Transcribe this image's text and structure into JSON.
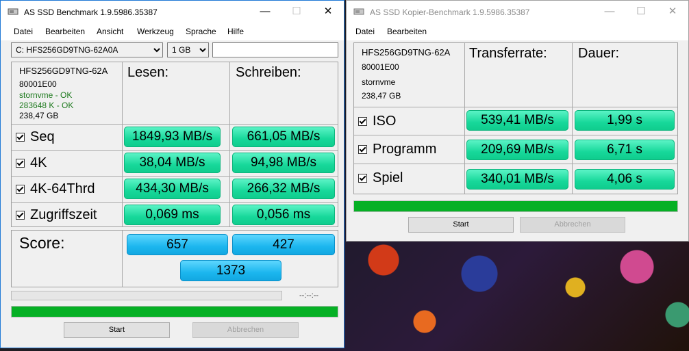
{
  "w1": {
    "title": "AS SSD Benchmark 1.9.5986.35387",
    "menu": [
      "Datei",
      "Bearbeiten",
      "Ansicht",
      "Werkzeug",
      "Sprache",
      "Hilfe"
    ],
    "drive_select": "C: HFS256GD9TNG-62A0A",
    "size_select": "1 GB",
    "info": {
      "model": "HFS256GD9TNG-62A",
      "fw": "80001E00",
      "driver": "stornvme - OK",
      "align": "283648 K - OK",
      "capacity": "238,47 GB"
    },
    "col_read": "Lesen:",
    "col_write": "Schreiben:",
    "rows": [
      {
        "label": "Seq",
        "read": "1849,93 MB/s",
        "write": "661,05 MB/s"
      },
      {
        "label": "4K",
        "read": "38,04 MB/s",
        "write": "94,98 MB/s"
      },
      {
        "label": "4K-64Thrd",
        "read": "434,30 MB/s",
        "write": "266,32 MB/s"
      },
      {
        "label": "Zugriffszeit",
        "read": "0,069 ms",
        "write": "0,056 ms"
      }
    ],
    "score_label": "Score:",
    "score_read": "657",
    "score_write": "427",
    "score_total": "1373",
    "timer": "--:--:--",
    "progress_top": 0,
    "progress_bottom": 1,
    "start": "Start",
    "abort": "Abbrechen",
    "colors": {
      "accent": "#1e78d6",
      "value": "#17d89a",
      "score": "#1bb6ee",
      "progress": "#06b025"
    }
  },
  "w2": {
    "title": "AS SSD Kopier-Benchmark 1.9.5986.35387",
    "menu": [
      "Datei",
      "Bearbeiten"
    ],
    "info": {
      "model": "HFS256GD9TNG-62A",
      "fw": "80001E00",
      "driver": "stornvme",
      "capacity": "238,47 GB"
    },
    "col_rate": "Transferrate:",
    "col_time": "Dauer:",
    "rows": [
      {
        "label": "ISO",
        "rate": "539,41 MB/s",
        "time": "1,99 s"
      },
      {
        "label": "Programm",
        "rate": "209,69 MB/s",
        "time": "6,71 s"
      },
      {
        "label": "Spiel",
        "rate": "340,01 MB/s",
        "time": "4,06 s"
      }
    ],
    "progress": 1,
    "start": "Start",
    "abort": "Abbrechen"
  }
}
